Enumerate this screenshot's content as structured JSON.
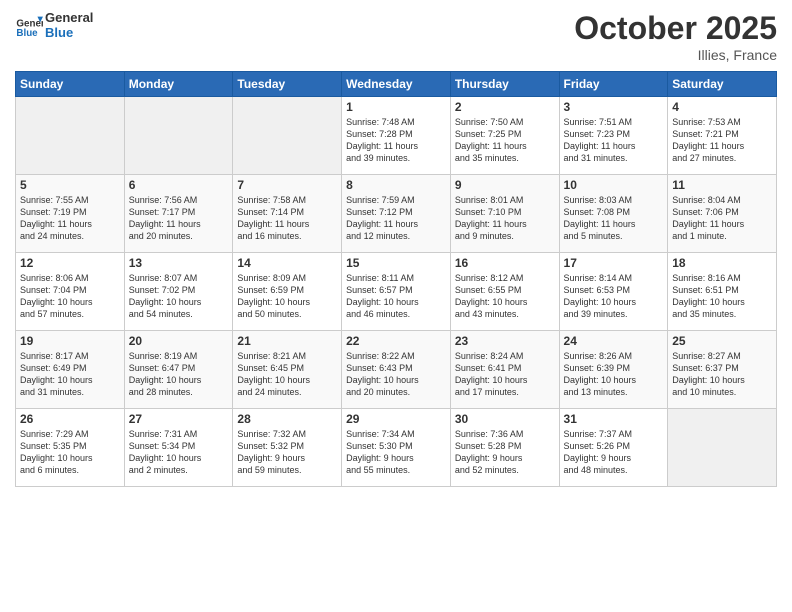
{
  "header": {
    "logo_text_general": "General",
    "logo_text_blue": "Blue",
    "month": "October 2025",
    "location": "Illies, France"
  },
  "days_of_week": [
    "Sunday",
    "Monday",
    "Tuesday",
    "Wednesday",
    "Thursday",
    "Friday",
    "Saturday"
  ],
  "weeks": [
    [
      {
        "day": "",
        "info": ""
      },
      {
        "day": "",
        "info": ""
      },
      {
        "day": "",
        "info": ""
      },
      {
        "day": "1",
        "info": "Sunrise: 7:48 AM\nSunset: 7:28 PM\nDaylight: 11 hours\nand 39 minutes."
      },
      {
        "day": "2",
        "info": "Sunrise: 7:50 AM\nSunset: 7:25 PM\nDaylight: 11 hours\nand 35 minutes."
      },
      {
        "day": "3",
        "info": "Sunrise: 7:51 AM\nSunset: 7:23 PM\nDaylight: 11 hours\nand 31 minutes."
      },
      {
        "day": "4",
        "info": "Sunrise: 7:53 AM\nSunset: 7:21 PM\nDaylight: 11 hours\nand 27 minutes."
      }
    ],
    [
      {
        "day": "5",
        "info": "Sunrise: 7:55 AM\nSunset: 7:19 PM\nDaylight: 11 hours\nand 24 minutes."
      },
      {
        "day": "6",
        "info": "Sunrise: 7:56 AM\nSunset: 7:17 PM\nDaylight: 11 hours\nand 20 minutes."
      },
      {
        "day": "7",
        "info": "Sunrise: 7:58 AM\nSunset: 7:14 PM\nDaylight: 11 hours\nand 16 minutes."
      },
      {
        "day": "8",
        "info": "Sunrise: 7:59 AM\nSunset: 7:12 PM\nDaylight: 11 hours\nand 12 minutes."
      },
      {
        "day": "9",
        "info": "Sunrise: 8:01 AM\nSunset: 7:10 PM\nDaylight: 11 hours\nand 9 minutes."
      },
      {
        "day": "10",
        "info": "Sunrise: 8:03 AM\nSunset: 7:08 PM\nDaylight: 11 hours\nand 5 minutes."
      },
      {
        "day": "11",
        "info": "Sunrise: 8:04 AM\nSunset: 7:06 PM\nDaylight: 11 hours\nand 1 minute."
      }
    ],
    [
      {
        "day": "12",
        "info": "Sunrise: 8:06 AM\nSunset: 7:04 PM\nDaylight: 10 hours\nand 57 minutes."
      },
      {
        "day": "13",
        "info": "Sunrise: 8:07 AM\nSunset: 7:02 PM\nDaylight: 10 hours\nand 54 minutes."
      },
      {
        "day": "14",
        "info": "Sunrise: 8:09 AM\nSunset: 6:59 PM\nDaylight: 10 hours\nand 50 minutes."
      },
      {
        "day": "15",
        "info": "Sunrise: 8:11 AM\nSunset: 6:57 PM\nDaylight: 10 hours\nand 46 minutes."
      },
      {
        "day": "16",
        "info": "Sunrise: 8:12 AM\nSunset: 6:55 PM\nDaylight: 10 hours\nand 43 minutes."
      },
      {
        "day": "17",
        "info": "Sunrise: 8:14 AM\nSunset: 6:53 PM\nDaylight: 10 hours\nand 39 minutes."
      },
      {
        "day": "18",
        "info": "Sunrise: 8:16 AM\nSunset: 6:51 PM\nDaylight: 10 hours\nand 35 minutes."
      }
    ],
    [
      {
        "day": "19",
        "info": "Sunrise: 8:17 AM\nSunset: 6:49 PM\nDaylight: 10 hours\nand 31 minutes."
      },
      {
        "day": "20",
        "info": "Sunrise: 8:19 AM\nSunset: 6:47 PM\nDaylight: 10 hours\nand 28 minutes."
      },
      {
        "day": "21",
        "info": "Sunrise: 8:21 AM\nSunset: 6:45 PM\nDaylight: 10 hours\nand 24 minutes."
      },
      {
        "day": "22",
        "info": "Sunrise: 8:22 AM\nSunset: 6:43 PM\nDaylight: 10 hours\nand 20 minutes."
      },
      {
        "day": "23",
        "info": "Sunrise: 8:24 AM\nSunset: 6:41 PM\nDaylight: 10 hours\nand 17 minutes."
      },
      {
        "day": "24",
        "info": "Sunrise: 8:26 AM\nSunset: 6:39 PM\nDaylight: 10 hours\nand 13 minutes."
      },
      {
        "day": "25",
        "info": "Sunrise: 8:27 AM\nSunset: 6:37 PM\nDaylight: 10 hours\nand 10 minutes."
      }
    ],
    [
      {
        "day": "26",
        "info": "Sunrise: 7:29 AM\nSunset: 5:35 PM\nDaylight: 10 hours\nand 6 minutes."
      },
      {
        "day": "27",
        "info": "Sunrise: 7:31 AM\nSunset: 5:34 PM\nDaylight: 10 hours\nand 2 minutes."
      },
      {
        "day": "28",
        "info": "Sunrise: 7:32 AM\nSunset: 5:32 PM\nDaylight: 9 hours\nand 59 minutes."
      },
      {
        "day": "29",
        "info": "Sunrise: 7:34 AM\nSunset: 5:30 PM\nDaylight: 9 hours\nand 55 minutes."
      },
      {
        "day": "30",
        "info": "Sunrise: 7:36 AM\nSunset: 5:28 PM\nDaylight: 9 hours\nand 52 minutes."
      },
      {
        "day": "31",
        "info": "Sunrise: 7:37 AM\nSunset: 5:26 PM\nDaylight: 9 hours\nand 48 minutes."
      },
      {
        "day": "",
        "info": ""
      }
    ]
  ]
}
